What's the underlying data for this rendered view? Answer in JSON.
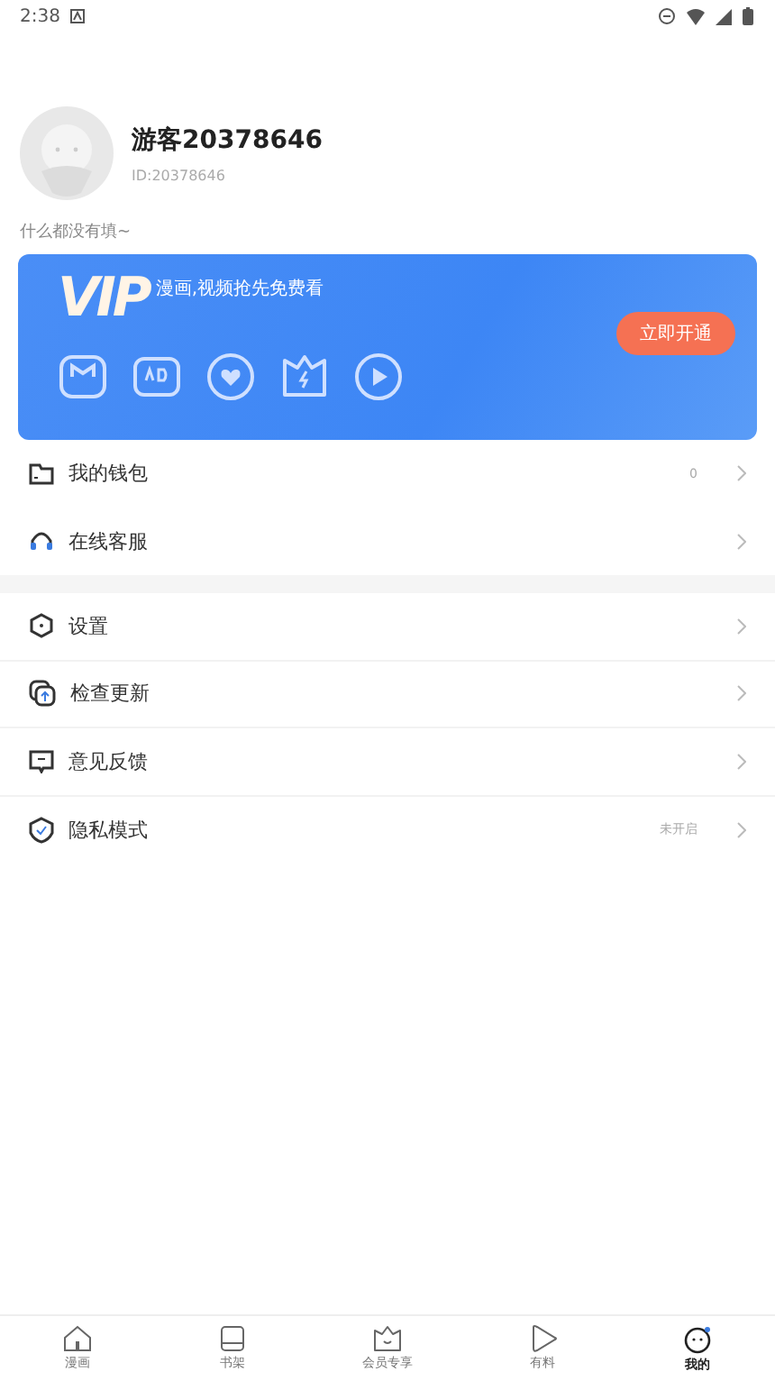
{
  "status_bar": {
    "time": "2:38"
  },
  "profile": {
    "name": "游客20378646",
    "id": "ID:20378646",
    "bio": "什么都没有填~"
  },
  "vip_banner": {
    "logo": "VIP",
    "tagline": "漫画,视频抢先免费看",
    "button": "立即开通"
  },
  "menu_groups": [
    {
      "items": [
        {
          "label": "我的钱包",
          "value": "0"
        },
        {
          "label": "在线客服"
        }
      ]
    },
    {
      "items": [
        {
          "label": "设置"
        },
        {
          "label": "检查更新"
        },
        {
          "label": "意见反馈"
        },
        {
          "label": "隐私模式",
          "value": "未开启"
        }
      ]
    }
  ],
  "tab_bar": [
    {
      "label": "漫画",
      "selected": false
    },
    {
      "label": "书架",
      "selected": false
    },
    {
      "label": "会员专享",
      "selected": false
    },
    {
      "label": "有料",
      "selected": false
    },
    {
      "label": "我的",
      "selected": true
    }
  ]
}
